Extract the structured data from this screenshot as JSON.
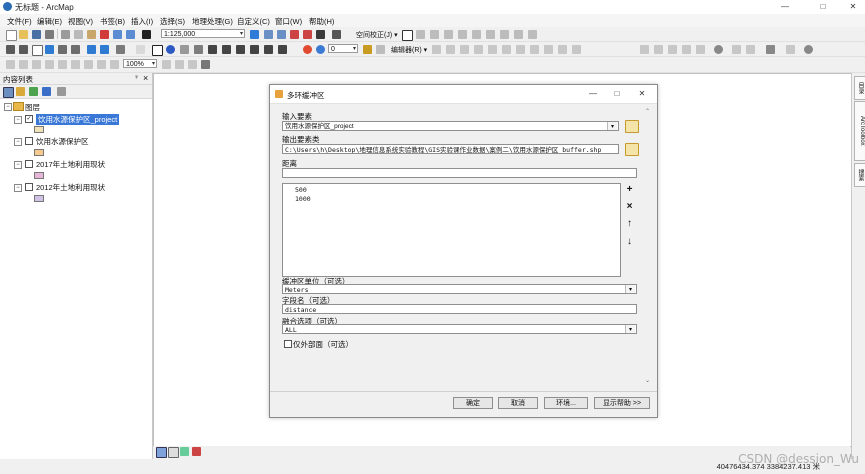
{
  "window": {
    "title": "无标题 - ArcMap",
    "minimize": "—",
    "maximize": "□",
    "close": "✕"
  },
  "menu": [
    "文件(F)",
    "编辑(E)",
    "视图(V)",
    "书签(B)",
    "插入(I)",
    "选择(S)",
    "地理处理(G)",
    "自定义(C)",
    "窗口(W)",
    "帮助(H)"
  ],
  "toolbar": {
    "scale": "1:125,000",
    "spatial_adjust": "空间校正(J) ▾",
    "editor": "编辑器(R) ▾",
    "zoom_pct": "100%"
  },
  "toc": {
    "title": "内容列表",
    "pin": "♀",
    "close": "×",
    "group": "图层",
    "layers": [
      {
        "name": "饮用水源保护区_project",
        "checked": true,
        "selected": true,
        "swatch": "#f0e2b8"
      },
      {
        "name": "饮用水源保护区",
        "checked": false,
        "selected": false,
        "swatch": "#f5c98f"
      },
      {
        "name": "2017年土地利用现状",
        "checked": false,
        "selected": false,
        "swatch": "#e6b6d9"
      },
      {
        "name": "2012年土地利用现状",
        "checked": false,
        "selected": false,
        "swatch": "#cfc2e6"
      }
    ]
  },
  "right_dock": [
    "目录",
    "ArcToolbox",
    "搜索"
  ],
  "status": {
    "coords": "40476434.374  3384237.413 米"
  },
  "watermark": "CSDN @dession_Wu",
  "dialog": {
    "title": "多环缓冲区",
    "minimize": "—",
    "maximize": "□",
    "close": "✕",
    "input_label": "输入要素",
    "input_value": "饮用水源保护区_project",
    "output_label": "输出要素类",
    "output_value": "C:\\Users\\h\\Desktop\\地理信息系统实验教程\\GIS实验课作业数据\\案例二\\饮用水源保护区_buffer.shp",
    "distances_label": "距离",
    "distances": [
      "500",
      "1000"
    ],
    "unit_label": "缓冲区单位（可选）",
    "unit_value": "Meters",
    "field_label": "字段名（可选）",
    "field_value": "distance",
    "dissolve_label": "融合选项（可选）",
    "dissolve_value": "ALL",
    "outside_label": "仅外部面（可选）",
    "side_buttons": [
      "+",
      "×",
      "↑",
      "↓"
    ],
    "ok": "确定",
    "cancel": "取消",
    "env": "环境...",
    "help": "显示帮助 >>"
  }
}
